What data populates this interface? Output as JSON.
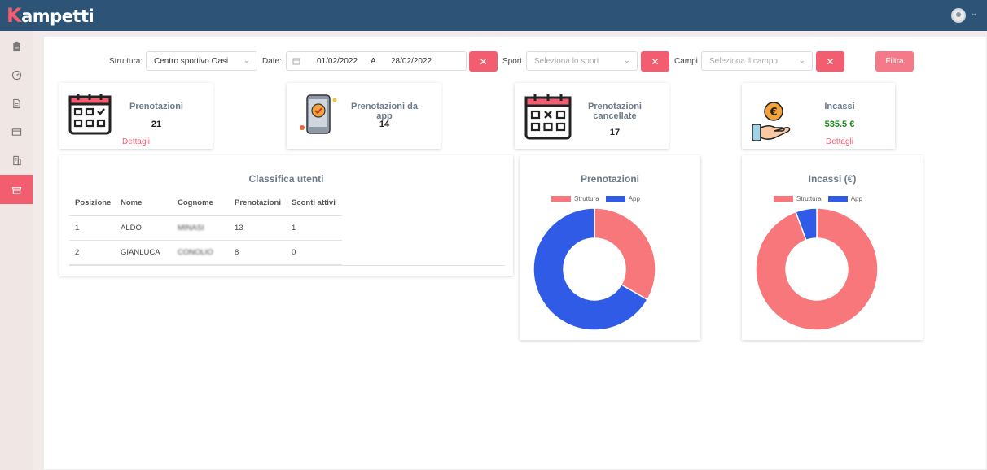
{
  "app": {
    "logo_k": "K",
    "logo_rest": "ampetti"
  },
  "filters": {
    "struttura_label": "Struttura:",
    "struttura_value": "Centro sportivo Oasi",
    "date_label": "Date:",
    "date_from": "01/02/2022",
    "date_sep": "A",
    "date_to": "28/02/2022",
    "sport_label": "Sport",
    "sport_placeholder": "Seleziona lo sport",
    "campi_label": "Campi",
    "campi_placeholder": "Seleziona il campo",
    "clear_symbol": "✕",
    "filter_button": "Filtra"
  },
  "cards": [
    {
      "title": "Prenotazioni",
      "value": "21",
      "link": "Dettagli",
      "icon": "calendar-check-icon"
    },
    {
      "title": "Prenotazioni da app",
      "value": "14",
      "icon": "phone-check-icon"
    },
    {
      "title_line1": "Prenotazioni",
      "title_line2": "cancellate",
      "value": "17",
      "icon": "calendar-cancel-icon"
    },
    {
      "title": "Incassi",
      "value": "535.5 €",
      "link": "Dettagli",
      "icon": "euro-hand-icon"
    }
  ],
  "ranking": {
    "title": "Classifica utenti",
    "columns": [
      "Posizione",
      "Nome",
      "Cognome",
      "Prenotazioni",
      "Sconti attivi"
    ],
    "rows": [
      [
        "1",
        "ALDO",
        "MINASI",
        "13",
        "1"
      ],
      [
        "2",
        "GIANLUCA",
        "CONOLIO",
        "8",
        "0"
      ]
    ]
  },
  "colors": {
    "struttura": "#f7777b",
    "app": "#2f5be6",
    "accent": "#f25d70"
  },
  "chart_data": [
    {
      "type": "pie",
      "title": "Prenotazioni",
      "categories": [
        "Struttura",
        "App"
      ],
      "values": [
        7,
        14
      ]
    },
    {
      "type": "pie",
      "title": "Incassi (€)",
      "categories": [
        "Struttura",
        "App"
      ],
      "values": [
        505.5,
        30
      ]
    }
  ]
}
